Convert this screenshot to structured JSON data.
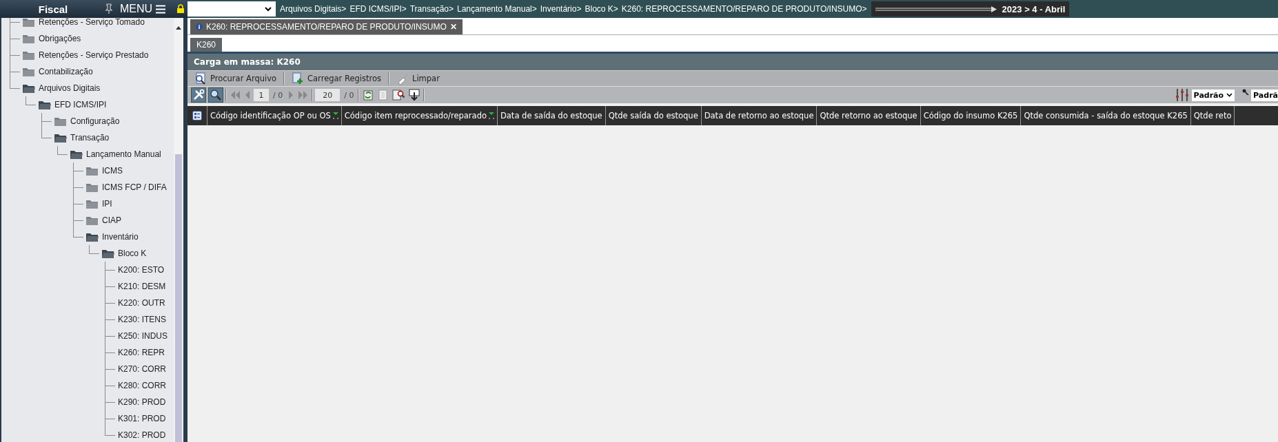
{
  "sidebar": {
    "title": "Fiscal",
    "menu_label": "MENU",
    "tree": [
      {
        "label": "Retenções - Serviço Tomado",
        "kind": "folder",
        "expanded": false
      },
      {
        "label": "Obrigações",
        "kind": "folder",
        "expanded": false
      },
      {
        "label": "Retenções - Serviço Prestado",
        "kind": "folder",
        "expanded": false
      },
      {
        "label": "Contabilização",
        "kind": "folder",
        "expanded": false
      },
      {
        "label": "Arquivos Digitais",
        "kind": "folder",
        "expanded": true,
        "children": [
          {
            "label": "EFD ICMS/IPI",
            "kind": "folder",
            "expanded": true,
            "children": [
              {
                "label": "Configuração",
                "kind": "folder",
                "expanded": false
              },
              {
                "label": "Transação",
                "kind": "folder",
                "expanded": true,
                "children": [
                  {
                    "label": "Lançamento Manual",
                    "kind": "folder",
                    "expanded": true,
                    "children": [
                      {
                        "label": "ICMS",
                        "kind": "folder",
                        "expanded": false
                      },
                      {
                        "label": "ICMS FCP / DIFA",
                        "kind": "folder",
                        "expanded": false
                      },
                      {
                        "label": "IPI",
                        "kind": "folder",
                        "expanded": false
                      },
                      {
                        "label": "CIAP",
                        "kind": "folder",
                        "expanded": false
                      },
                      {
                        "label": "Inventário",
                        "kind": "folder",
                        "expanded": true,
                        "children": [
                          {
                            "label": "Bloco K",
                            "kind": "folder",
                            "expanded": true,
                            "children": [
                              {
                                "label": "K200: ESTO",
                                "kind": "leaf"
                              },
                              {
                                "label": "K210: DESM",
                                "kind": "leaf"
                              },
                              {
                                "label": "K220: OUTR",
                                "kind": "leaf"
                              },
                              {
                                "label": "K230: ITENS",
                                "kind": "leaf"
                              },
                              {
                                "label": "K250: INDUS",
                                "kind": "leaf"
                              },
                              {
                                "label": "K260: REPR",
                                "kind": "leaf"
                              },
                              {
                                "label": "K270: CORR",
                                "kind": "leaf"
                              },
                              {
                                "label": "K280: CORR",
                                "kind": "leaf"
                              },
                              {
                                "label": "K290: PROD",
                                "kind": "leaf"
                              },
                              {
                                "label": "K301: PROD",
                                "kind": "leaf"
                              },
                              {
                                "label": "K302: PROD",
                                "kind": "leaf"
                              }
                            ]
                          }
                        ]
                      }
                    ]
                  }
                ]
              }
            ]
          }
        ]
      }
    ]
  },
  "breadcrumb": {
    "items": [
      "Arquivos Digitais>",
      "EFD ICMS/IPI>",
      "Transação>",
      "Lançamento Manual>",
      "Inventário>",
      "Bloco K>",
      "K260: REPROCESSAMENTO/REPARO DE PRODUTO/INSUMO>"
    ],
    "period": "2023 > 4 - Abril"
  },
  "document_tab": {
    "label": "K260: REPROCESSAMENTO/REPARO DE PRODUTO/INSUMO",
    "close": "✕"
  },
  "sub_tabs": [
    {
      "label": "K260",
      "selected": true
    }
  ],
  "panel": {
    "title": "Carga em massa: K260",
    "actions": [
      {
        "label": "Procurar Arquivo",
        "kind": "search"
      },
      {
        "label": "Carregar Registros",
        "kind": "add"
      },
      {
        "label": "Limpar",
        "kind": "clear"
      }
    ]
  },
  "pager": {
    "page": "1",
    "page_total": "/ 0",
    "page_size": "20",
    "record_total": "/ 0",
    "view_select": "Padrão",
    "filter_select": "Padrã"
  },
  "table": {
    "columns": [
      {
        "label": "Código identificação OP ou OS",
        "filter": true
      },
      {
        "label": "Código item reprocessado/reparado",
        "filter": true
      },
      {
        "label": "Data de saída do estoque",
        "filter": false
      },
      {
        "label": "Qtde saída do estoque",
        "filter": false
      },
      {
        "label": "Data de retorno ao estoque",
        "filter": false
      },
      {
        "label": "Qtde retorno ao estoque",
        "filter": false
      },
      {
        "label": "Código do insumo K265",
        "filter": false
      },
      {
        "label": "Qtde consumida - saída do estoque K265",
        "filter": false
      },
      {
        "label": "Qtde reto",
        "filter": false
      }
    ]
  }
}
